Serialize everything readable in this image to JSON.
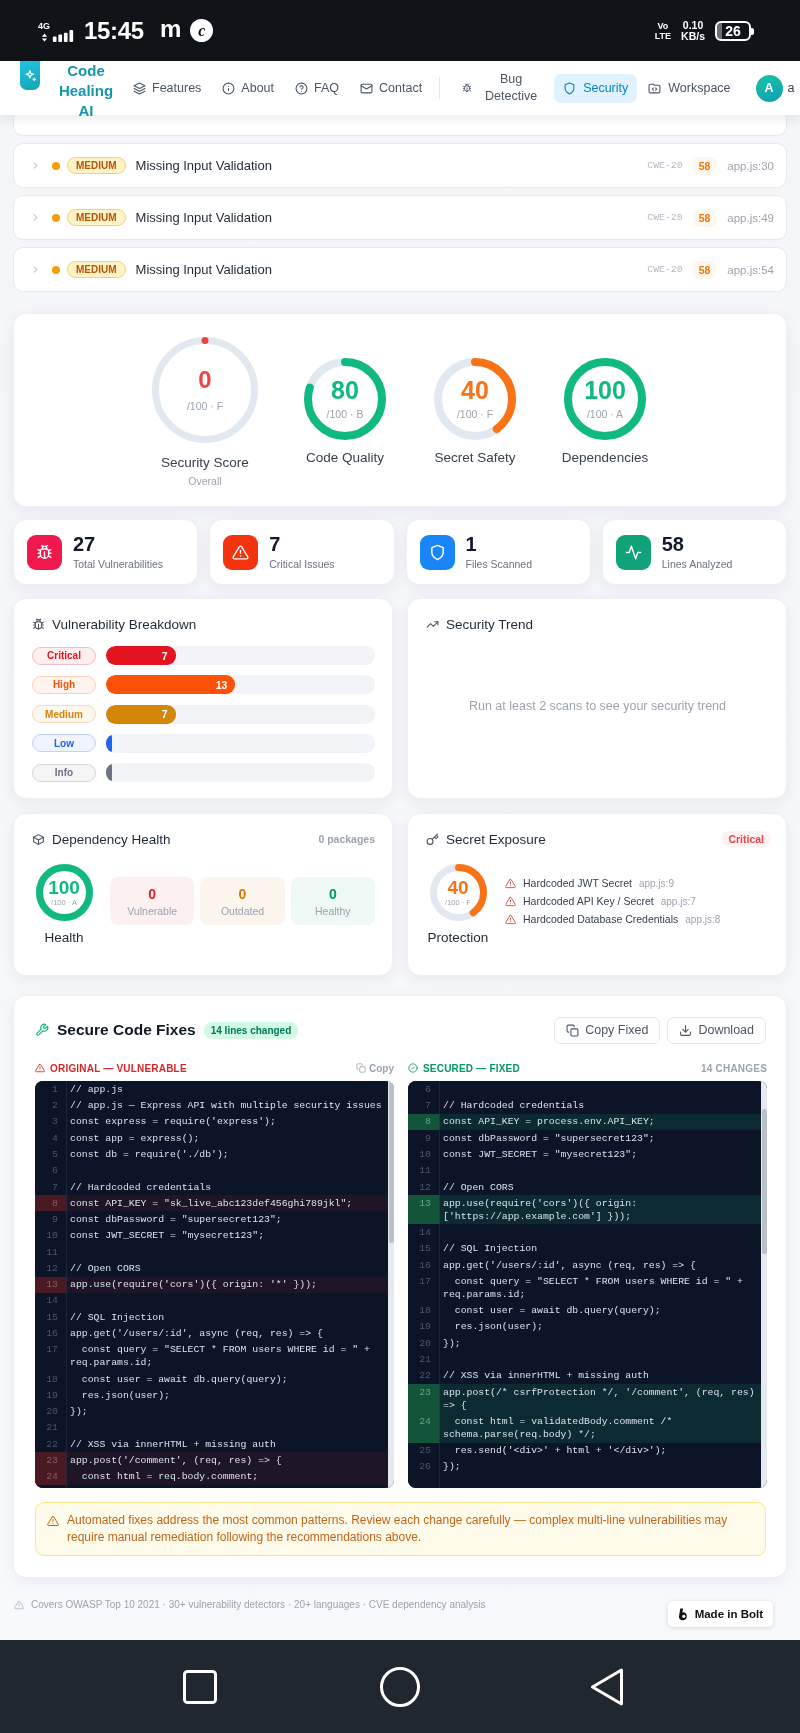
{
  "status_bar": {
    "network": "4G",
    "time": "15:45",
    "notifications": [
      "m",
      "c"
    ],
    "volte": [
      "Vo",
      "LTE"
    ],
    "speed": [
      "0.10",
      "KB/s"
    ],
    "battery": "26"
  },
  "nav": {
    "brand": "Code Healing AI",
    "links": [
      {
        "label": "Features"
      },
      {
        "label": "About"
      },
      {
        "label": "FAQ"
      },
      {
        "label": "Contact"
      }
    ],
    "tools": [
      {
        "label": "Bug Detective",
        "selected": false
      },
      {
        "label": "Security",
        "selected": true
      },
      {
        "label": "Workspace",
        "selected": false
      }
    ],
    "avatar": "A",
    "user": "a"
  },
  "issues": [
    {
      "severity": "MEDIUM",
      "title": "Missing Input Validation",
      "cwe": "CWE-20",
      "score": "58",
      "location": "app.js:30",
      "expanded": false
    },
    {
      "severity": "MEDIUM",
      "title": "Missing Input Validation",
      "cwe": "CWE-20",
      "score": "58",
      "location": "app.js:49",
      "expanded": false
    },
    {
      "severity": "MEDIUM",
      "title": "Missing Input Validation",
      "cwe": "CWE-20",
      "score": "58",
      "location": "app.js:54",
      "expanded": false
    }
  ],
  "scores": [
    {
      "kind": "primary",
      "value": "0",
      "grade": "/100 · F",
      "label": "Security Score",
      "sublabel": "Overall",
      "level": 0,
      "color": "#ef4444"
    },
    {
      "kind": "secondary",
      "value": "80",
      "grade": "/100 · B",
      "label": "Code Quality",
      "level": 0.8,
      "color": "#10b981"
    },
    {
      "kind": "secondary",
      "value": "40",
      "grade": "/100 · F",
      "label": "Secret Safety",
      "level": 0.4,
      "color": "#f97316"
    },
    {
      "kind": "secondary",
      "value": "100",
      "grade": "/100 · A",
      "label": "Dependencies",
      "level": 1,
      "color": "#10b981"
    }
  ],
  "stats": [
    {
      "value": "27",
      "label": "Total Vulnerabilities",
      "color": "#f0194f"
    },
    {
      "value": "7",
      "label": "Critical Issues",
      "color": "#f4330f"
    },
    {
      "value": "1",
      "label": "Files Scanned",
      "color": "#1a86f5"
    },
    {
      "value": "58",
      "label": "Lines Analyzed",
      "color": "#10a37a"
    }
  ],
  "breakdown": {
    "title": "Vulnerability Breakdown",
    "rows": [
      {
        "label": "Critical",
        "value": "7",
        "level": 0.259,
        "color": "#e5121f"
      },
      {
        "label": "High",
        "value": "13",
        "level": 0.481,
        "color": "#fb5208"
      },
      {
        "label": "Medium",
        "value": "7",
        "level": 0.259,
        "color": "#d4860b"
      },
      {
        "label": "Low",
        "level": 0,
        "color": "#2563eb"
      },
      {
        "label": "Info",
        "level": 0,
        "color": "#6b7280"
      }
    ]
  },
  "trend": {
    "title": "Security Trend",
    "empty_message": "Run at least 2 scans to see your security trend"
  },
  "dependency": {
    "title": "Dependency Health",
    "count": "0 packages",
    "score": {
      "value": "100",
      "grade": "/100 · A",
      "label": "Health",
      "level": 1,
      "color": "#10b981"
    },
    "stats": [
      {
        "value": "0",
        "label": "Vulnerable",
        "color": "#dc2626"
      },
      {
        "value": "0",
        "label": "Outdated",
        "color": "#d97706"
      },
      {
        "value": "0",
        "label": "Healthy",
        "color": "#059669"
      }
    ]
  },
  "secrets": {
    "title": "Secret Exposure",
    "badge": "Critical",
    "score": {
      "value": "40",
      "grade": "/100 · F",
      "label": "Protection",
      "level": 0.4,
      "color": "#f97316"
    },
    "items": [
      {
        "name": "Hardcoded JWT Secret",
        "location": "app.js:9"
      },
      {
        "name": "Hardcoded API Key / Secret",
        "location": "app.js:7"
      },
      {
        "name": "Hardcoded Database Credentials",
        "location": "app.js:8"
      }
    ]
  },
  "fixes": {
    "title": "Secure Code Fixes",
    "badge": "14 lines changed",
    "buttons": [
      "Copy Fixed",
      "Download"
    ],
    "original": {
      "label": "ORIGINAL — VULNERABLE",
      "action": "Copy",
      "lines": [
        {
          "n": "1",
          "code": "// app.js",
          "changed": false
        },
        {
          "n": "2",
          "code": "// app.js — Express API with multiple security issues",
          "changed": false
        },
        {
          "n": "3",
          "code": "const express = require('express');",
          "changed": false
        },
        {
          "n": "4",
          "code": "const app = express();",
          "changed": false
        },
        {
          "n": "5",
          "code": "const db = require('./db');",
          "changed": false
        },
        {
          "n": "6",
          "changed": false
        },
        {
          "n": "7",
          "code": "// Hardcoded credentials",
          "changed": false
        },
        {
          "n": "8",
          "code": "const API_KEY = \"sk_live_abc123def456ghi789jkl\";",
          "changed": true
        },
        {
          "n": "9",
          "code": "const dbPassword = \"supersecret123\";",
          "changed": false
        },
        {
          "n": "10",
          "code": "const JWT_SECRET = \"mysecret123\";",
          "changed": false
        },
        {
          "n": "11",
          "changed": false
        },
        {
          "n": "12",
          "code": "// Open CORS",
          "changed": false
        },
        {
          "n": "13",
          "code": "app.use(require('cors')({ origin: '*' }));",
          "changed": true
        },
        {
          "n": "14",
          "changed": false
        },
        {
          "n": "15",
          "code": "// SQL Injection",
          "changed": false
        },
        {
          "n": "16",
          "code": "app.get('/users/:id', async (req, res) => {",
          "changed": false
        },
        {
          "n": "17",
          "code": "  const query = \"SELECT * FROM users WHERE id = \" + req.params.id;",
          "changed": false
        },
        {
          "n": "18",
          "code": "  const user = await db.query(query);",
          "changed": false
        },
        {
          "n": "19",
          "code": "  res.json(user);",
          "changed": false
        },
        {
          "n": "20",
          "code": "});",
          "changed": false
        },
        {
          "n": "21",
          "changed": false
        },
        {
          "n": "22",
          "code": "// XSS via innerHTML + missing auth",
          "changed": false
        },
        {
          "n": "23",
          "code": "app.post('/comment', (req, res) => {",
          "changed": true
        },
        {
          "n": "24",
          "code": "  const html = req.body.comment;",
          "changed": true
        }
      ]
    },
    "fixed": {
      "label": "SECURED — FIXED",
      "count": "14 CHANGES",
      "lines": [
        {
          "n": "6",
          "changed": false
        },
        {
          "n": "7",
          "code": "// Hardcoded credentials",
          "changed": false
        },
        {
          "n": "8",
          "code": "const API_KEY = process.env.API_KEY;",
          "changed": true
        },
        {
          "n": "9",
          "code": "const dbPassword = \"supersecret123\";",
          "changed": false
        },
        {
          "n": "10",
          "code": "const JWT_SECRET = \"mysecret123\";",
          "changed": false
        },
        {
          "n": "11",
          "changed": false
        },
        {
          "n": "12",
          "code": "// Open CORS",
          "changed": false
        },
        {
          "n": "13",
          "code": "app.use(require('cors')({ origin: ['https://app.example.com'] }));",
          "changed": true
        },
        {
          "n": "14",
          "changed": false
        },
        {
          "n": "15",
          "code": "// SQL Injection",
          "changed": false
        },
        {
          "n": "16",
          "code": "app.get('/users/:id', async (req, res) => {",
          "changed": false
        },
        {
          "n": "17",
          "code": "  const query = \"SELECT * FROM users WHERE id = \" + req.params.id;",
          "changed": false
        },
        {
          "n": "18",
          "code": "  const user = await db.query(query);",
          "changed": false
        },
        {
          "n": "19",
          "code": "  res.json(user);",
          "changed": false
        },
        {
          "n": "20",
          "code": "});",
          "changed": false
        },
        {
          "n": "21",
          "changed": false
        },
        {
          "n": "22",
          "code": "// XSS via innerHTML + missing auth",
          "changed": false
        },
        {
          "n": "23",
          "code": "app.post(/* csrfProtection */, '/comment', (req, res) => {",
          "changed": true
        },
        {
          "n": "24",
          "code": "  const html = validatedBody.comment /* schema.parse(req.body) */;",
          "changed": true
        },
        {
          "n": "25",
          "code": "  res.send('<div>' + html + '</div>');",
          "changed": false
        },
        {
          "n": "26",
          "code": "});",
          "changed": false
        }
      ]
    },
    "note": "Automated fixes address the most common patterns. Review each change carefully — complex multi-line vulnerabilities may require manual remediation following the recommendations above."
  },
  "footer": {
    "note": "Covers OWASP Top 10 2021 · 30+ vulnerability detectors · 20+ languages · CVE dependency analysis",
    "badge": "Made in Bolt"
  }
}
